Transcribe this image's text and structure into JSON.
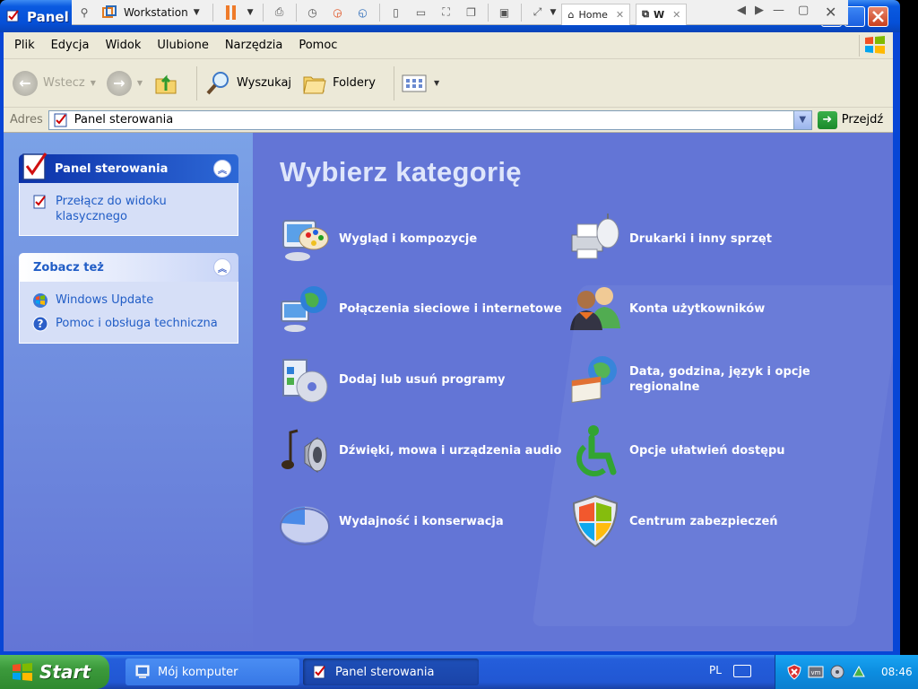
{
  "window": {
    "title": "Panel",
    "colors": {
      "titlebar": "#0550d8",
      "content_bg": "#6375d6",
      "taskpane_link": "#215dc6"
    }
  },
  "vm_toolbar": {
    "vm_name": "Workstation",
    "tabs": [
      {
        "label": "Home",
        "icon": "home-icon"
      },
      {
        "label": "W",
        "icon": "vm-tab-icon"
      }
    ]
  },
  "menu": {
    "items": [
      "Plik",
      "Edycja",
      "Widok",
      "Ulubione",
      "Narzędzia",
      "Pomoc"
    ]
  },
  "toolbar": {
    "back_label": "Wstecz",
    "search_label": "Wyszukaj",
    "folders_label": "Foldery"
  },
  "address": {
    "label": "Adres",
    "value": "Panel sterowania",
    "go_label": "Przejdź"
  },
  "left_pane": {
    "control_panel_box": {
      "title": "Panel sterowania",
      "links": [
        {
          "label": "Przełącz do widoku klasycznego",
          "icon": "switch-view-icon"
        }
      ]
    },
    "see_also_box": {
      "title": "Zobacz też",
      "links": [
        {
          "label": "Windows Update",
          "icon": "windows-update-icon"
        },
        {
          "label": "Pomoc i obsługa techniczna",
          "icon": "help-icon"
        }
      ]
    }
  },
  "main": {
    "heading": "Wybierz kategorię",
    "categories": [
      {
        "label": "Wygląd i kompozycje",
        "icon": "appearance-icon"
      },
      {
        "label": "Drukarki i inny sprzęt",
        "icon": "printer-icon"
      },
      {
        "label": "Połączenia sieciowe i internetowe",
        "icon": "network-icon"
      },
      {
        "label": "Konta użytkowników",
        "icon": "user-accounts-icon"
      },
      {
        "label": "Dodaj lub usuń programy",
        "icon": "add-remove-programs-icon"
      },
      {
        "label": "Data, godzina, język i opcje regionalne",
        "icon": "date-time-language-icon"
      },
      {
        "label": "Dźwięki, mowa i urządzenia audio",
        "icon": "sounds-icon"
      },
      {
        "label": "Opcje ułatwień dostępu",
        "icon": "accessibility-icon"
      },
      {
        "label": "Wydajność i konserwacja",
        "icon": "performance-icon"
      },
      {
        "label": "Centrum zabezpieczeń",
        "icon": "security-center-icon"
      }
    ]
  },
  "taskbar": {
    "start_label": "Start",
    "items": [
      {
        "label": "Mój komputer",
        "icon": "my-computer-icon",
        "active": false
      },
      {
        "label": "Panel sterowania",
        "icon": "control-panel-icon",
        "active": true
      }
    ],
    "language": "PL",
    "clock": "08:46"
  }
}
